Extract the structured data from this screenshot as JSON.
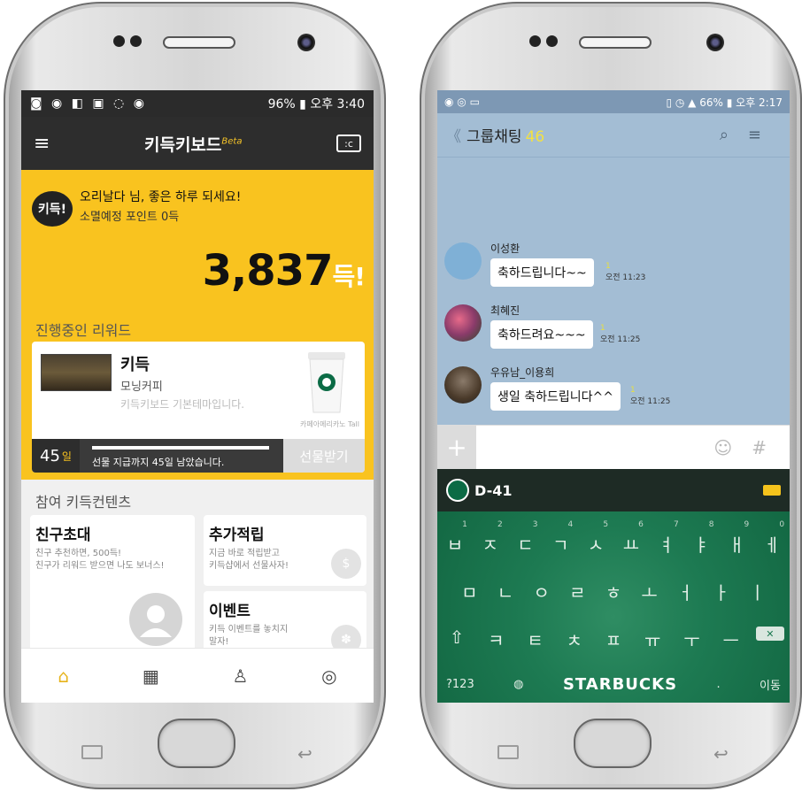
{
  "left_phone": {
    "status_bar": {
      "icons": "◙ ◉ ◧ ▣ ◌ ◉",
      "right": "96%",
      "time": "오후 3:40"
    },
    "header": {
      "title": "키득키보드",
      "beta": "Beta",
      "card_icon": ":c"
    },
    "greeting": {
      "badge": "키득!",
      "line1": "오리날다 님, 좋은 하루 되세요!",
      "line2": "소멸예정 포인트 0득"
    },
    "points": {
      "value": "3,837",
      "unit": "득!"
    },
    "reward": {
      "heading": "진행중인 리워드",
      "title": "키득",
      "subtitle": "모닝커피",
      "desc": "키득키보드 기본테마입니다.",
      "product_label": "카페아메리카노 Tall",
      "days": "45",
      "days_unit": "일",
      "progress_text": "선물 지급까지 45일 남았습니다.",
      "claim_label": "선물받기"
    },
    "contents": {
      "heading": "참여 키득컨텐츠",
      "invite": {
        "title": "친구초대",
        "desc1": "친구 추천하면, 500득!",
        "desc2": "친구가 리워드 받으면 나도 보너스!"
      },
      "extra": {
        "title": "추가적립",
        "desc1": "지금 바로 적립받고",
        "desc2": "키득샵에서 선물사자!"
      },
      "event": {
        "title": "이벤트",
        "desc1": "키득 이벤트를 놓치지",
        "desc2": "말자!"
      }
    },
    "bottom_nav": [
      {
        "name": "home-icon",
        "glyph": "⌂"
      },
      {
        "name": "shop-icon",
        "glyph": "▦"
      },
      {
        "name": "brush-icon",
        "glyph": "♙"
      },
      {
        "name": "coins-icon",
        "glyph": "◎"
      }
    ]
  },
  "right_phone": {
    "status_bar": {
      "left": "◉ ◎ ▭",
      "right": "66%",
      "time": "오후 2:17"
    },
    "header": {
      "back": "《",
      "title": "그룹채팅",
      "count": "46",
      "search": "⌕",
      "menu": "≡"
    },
    "messages": [
      {
        "name": "이성환",
        "text": "축하드립니다~~",
        "unread": "1",
        "time": "오전 11:23"
      },
      {
        "name": "최혜진",
        "text": "축하드려요~~~",
        "unread": "1",
        "time": "오전 11:25"
      },
      {
        "name": "우유남_이용희",
        "text": "생일 축하드립니다^^",
        "unread": "1",
        "time": "오전 11:25"
      }
    ],
    "input": {
      "plus": "+",
      "emoji": "☺",
      "hash": "#"
    },
    "keyboard": {
      "dday": "D-41",
      "row1": [
        "ㅂ",
        "ㅈ",
        "ㄷ",
        "ㄱ",
        "ㅅ",
        "ㅛ",
        "ㅕ",
        "ㅑ",
        "ㅐ",
        "ㅔ"
      ],
      "row1_hints": [
        "1",
        "2",
        "3",
        "4",
        "5",
        "6",
        "7",
        "8",
        "9",
        "0"
      ],
      "row2": [
        "ㅁ",
        "ㄴ",
        "ㅇ",
        "ㄹ",
        "ㅎ",
        "ㅗ",
        "ㅓ",
        "ㅏ",
        "ㅣ"
      ],
      "row3": [
        "⇧",
        "ㅋ",
        "ㅌ",
        "ㅊ",
        "ㅍ",
        "ㅠ",
        "ㅜ",
        "ㅡ"
      ],
      "num_key": "?123",
      "brand": "STARBUCKS",
      "move_key": "이동",
      "delete_glyph": "✕"
    }
  }
}
